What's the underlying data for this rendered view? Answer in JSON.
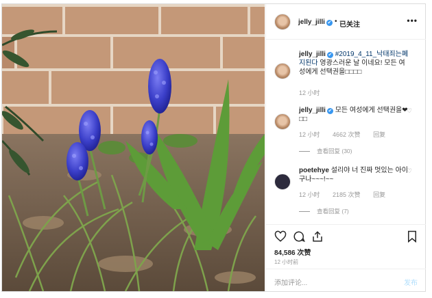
{
  "header": {
    "username": "jelly_jilli",
    "verified_mark": "✔",
    "separator": "•",
    "follow_label": "已关注",
    "more_label": "•••"
  },
  "caption": {
    "username": "jelly_jilli",
    "hashtag": "#2019_4_11_낙태죄는폐지된다",
    "text": "영광스러운 날 이네요! 모든 여성에게 선택권을□□□□",
    "time": "12 小时"
  },
  "comments": [
    {
      "username": "jelly_jilli",
      "text": "모든 여성에게 선택권을❤□□",
      "time": "12 小时",
      "likes": "4662 次赞",
      "reply_label": "回复",
      "view_replies": "查看回复 (30)"
    },
    {
      "username": "poetehye",
      "text": "설리야 너 진짜 멋있는 아이구나~~~!~~",
      "time": "12 小时",
      "likes": "2185 次赞",
      "reply_label": "回复",
      "view_replies": "查看回复 (7)"
    }
  ],
  "actions": {
    "likes_count": "84,586 次赞",
    "timestamp": "12 小时前",
    "icons": [
      "heart-icon",
      "comment-icon",
      "share-icon",
      "bookmark-icon"
    ]
  },
  "add_comment": {
    "placeholder": "添加评论...",
    "post_label": "发布"
  },
  "colors": {
    "link_blue": "#003569",
    "verified_blue": "#3897f0",
    "muted": "#999999",
    "border": "#dbdbdb"
  }
}
